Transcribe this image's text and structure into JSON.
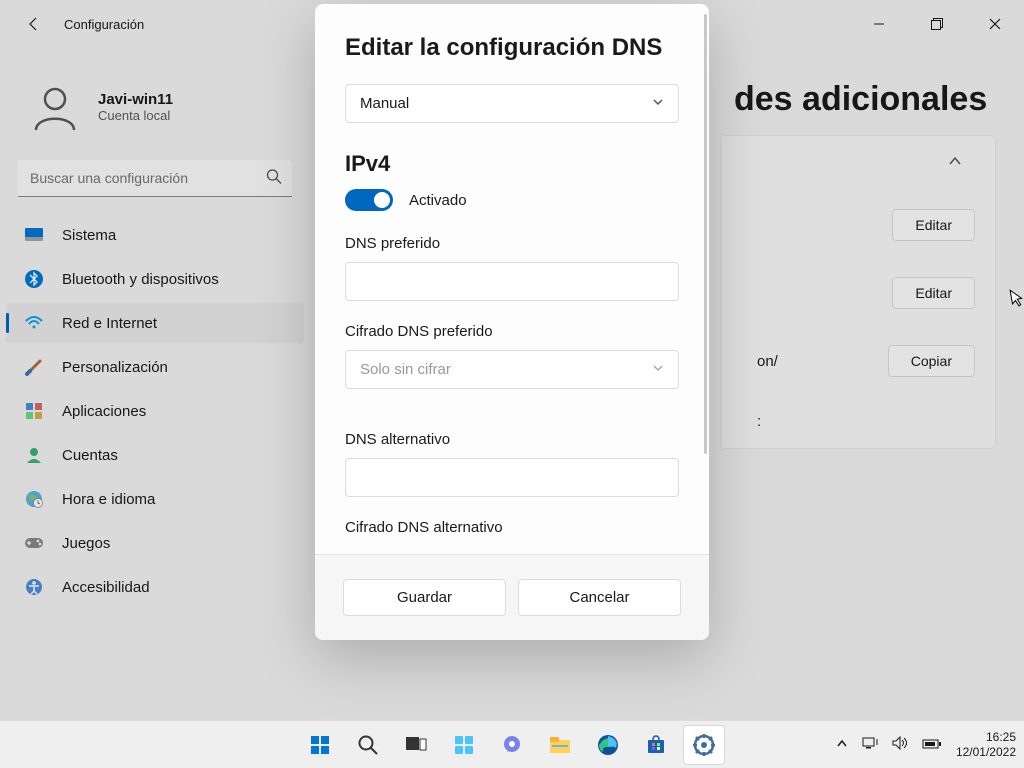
{
  "titlebar": {
    "title": "Configuración"
  },
  "user": {
    "name": "Javi-win11",
    "sub": "Cuenta local"
  },
  "search": {
    "placeholder": "Buscar una configuración"
  },
  "nav": {
    "sistema": "Sistema",
    "bluetooth": "Bluetooth y dispositivos",
    "red": "Red e Internet",
    "personalizacion": "Personalización",
    "aplicaciones": "Aplicaciones",
    "cuentas": "Cuentas",
    "hora": "Hora e idioma",
    "juegos": "Juegos",
    "accesibilidad": "Accesibilidad"
  },
  "main": {
    "heading_fragment": "des adicionales",
    "edit1": "Editar",
    "edit2": "Editar",
    "link_fragment1": "on/",
    "link_fragment2": ":",
    "copy": "Copiar"
  },
  "modal": {
    "title": "Editar la configuración DNS",
    "mode": "Manual",
    "ipv4_label": "IPv4",
    "toggle_text": "Activado",
    "dns_pref_label": "DNS preferido",
    "enc_pref_label": "Cifrado DNS preferido",
    "enc_pref_value": "Solo sin cifrar",
    "dns_alt_label": "DNS alternativo",
    "enc_alt_label": "Cifrado DNS alternativo",
    "save": "Guardar",
    "cancel": "Cancelar"
  },
  "clock": {
    "time": "16:25",
    "date": "12/01/2022"
  }
}
